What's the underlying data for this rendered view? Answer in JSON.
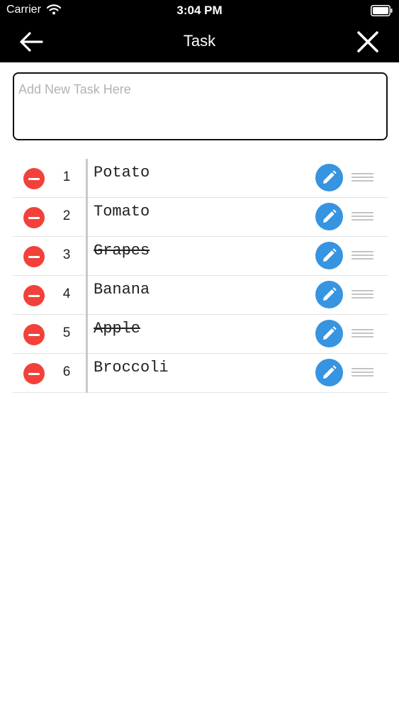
{
  "status_bar": {
    "carrier": "Carrier",
    "time": "3:04 PM",
    "icons": [
      "wifi-icon",
      "battery-icon"
    ]
  },
  "nav": {
    "title": "Task",
    "back_icon": "arrow-left-icon",
    "close_icon": "close-icon"
  },
  "new_task": {
    "placeholder": "Add New Task Here",
    "value": ""
  },
  "tasks": [
    {
      "number": "1",
      "name": "Potato",
      "done": false
    },
    {
      "number": "2",
      "name": "Tomato",
      "done": false
    },
    {
      "number": "3",
      "name": "Grapes",
      "done": true
    },
    {
      "number": "4",
      "name": "Banana",
      "done": false
    },
    {
      "number": "5",
      "name": "Apple",
      "done": true
    },
    {
      "number": "6",
      "name": "Broccoli",
      "done": false
    }
  ],
  "row_icons": {
    "delete": "minus-circle-icon",
    "edit": "pencil-icon",
    "drag": "drag-handle-icon"
  },
  "colors": {
    "bar_background": "#000000",
    "delete_red": "#f2413a",
    "edit_blue": "#3694e0",
    "placeholder_gray": "#b3b3b3"
  }
}
